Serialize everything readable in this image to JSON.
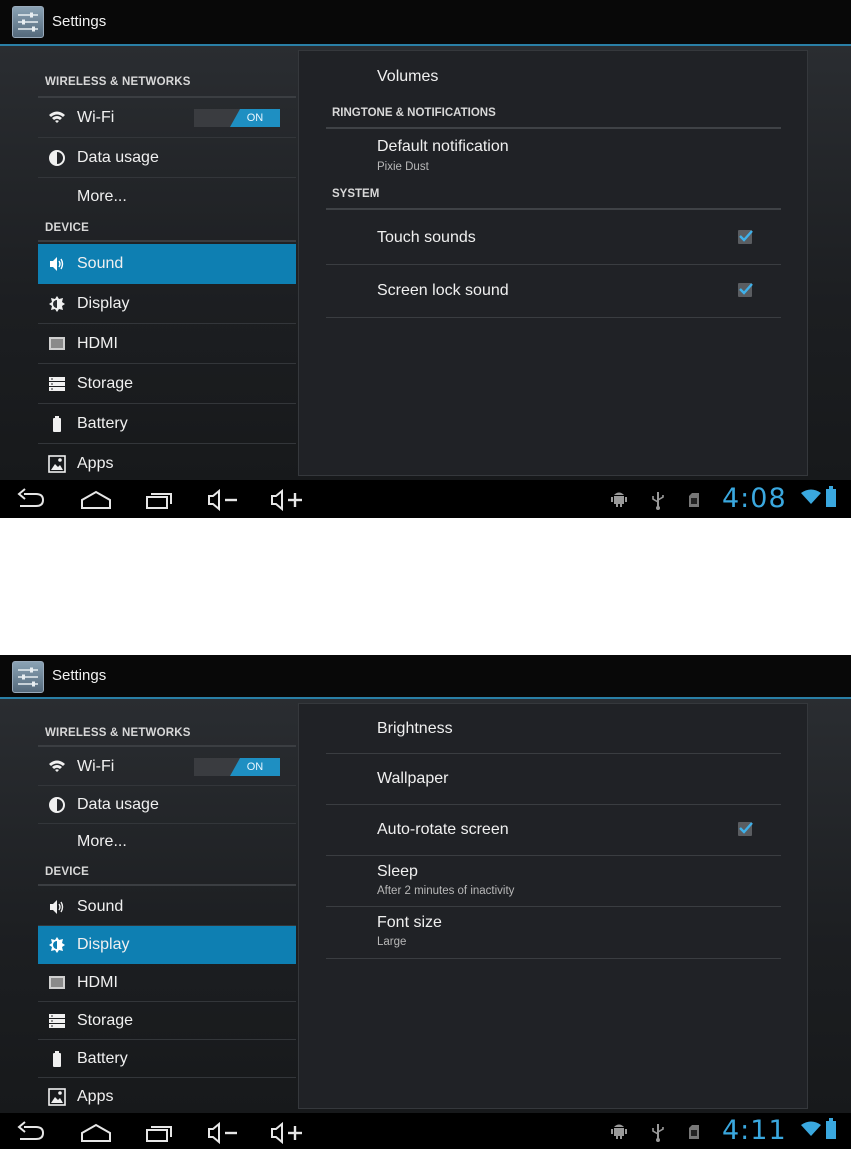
{
  "screens": [
    {
      "app_title": "Settings",
      "left": {
        "header_wireless": "WIRELESS & NETWORKS",
        "wifi": "Wi-Fi",
        "wifi_toggle": "ON",
        "data_usage": "Data usage",
        "more": "More...",
        "header_device": "DEVICE",
        "sound": "Sound",
        "display": "Display",
        "hdmi": "HDMI",
        "storage": "Storage",
        "battery": "Battery",
        "apps": "Apps",
        "selected": "Sound"
      },
      "right": {
        "volumes": "Volumes",
        "cat_ringtone": "RINGTONE & NOTIFICATIONS",
        "default_notification": "Default notification",
        "default_notification_value": "Pixie Dust",
        "cat_system": "SYSTEM",
        "touch_sounds": "Touch sounds",
        "touch_sounds_checked": true,
        "screen_lock_sound": "Screen lock sound",
        "screen_lock_sound_checked": true
      },
      "status": {
        "clock": "4:08"
      }
    },
    {
      "app_title": "Settings",
      "left": {
        "header_wireless": "WIRELESS & NETWORKS",
        "wifi": "Wi-Fi",
        "wifi_toggle": "ON",
        "data_usage": "Data usage",
        "more": "More...",
        "header_device": "DEVICE",
        "sound": "Sound",
        "display": "Display",
        "hdmi": "HDMI",
        "storage": "Storage",
        "battery": "Battery",
        "apps": "Apps",
        "selected": "Display"
      },
      "right": {
        "brightness": "Brightness",
        "wallpaper": "Wallpaper",
        "auto_rotate": "Auto-rotate screen",
        "auto_rotate_checked": true,
        "sleep": "Sleep",
        "sleep_value": "After 2 minutes of inactivity",
        "font_size": "Font size",
        "font_size_value": "Large"
      },
      "status": {
        "clock": "4:11"
      }
    }
  ],
  "colors": {
    "accent": "#0e7fb2",
    "clock": "#3aa8df",
    "toggle_on": "#1e8fc2"
  },
  "icons": [
    "settings-app-icon",
    "wifi-icon",
    "data-usage-icon",
    "sound-icon",
    "display-icon",
    "hdmi-icon",
    "storage-icon",
    "battery-icon",
    "apps-icon",
    "back-icon",
    "home-icon",
    "recent-apps-icon",
    "volume-down-icon",
    "volume-up-icon",
    "android-debug-icon",
    "usb-icon",
    "sd-card-icon",
    "wifi-signal-icon",
    "battery-status-icon"
  ]
}
